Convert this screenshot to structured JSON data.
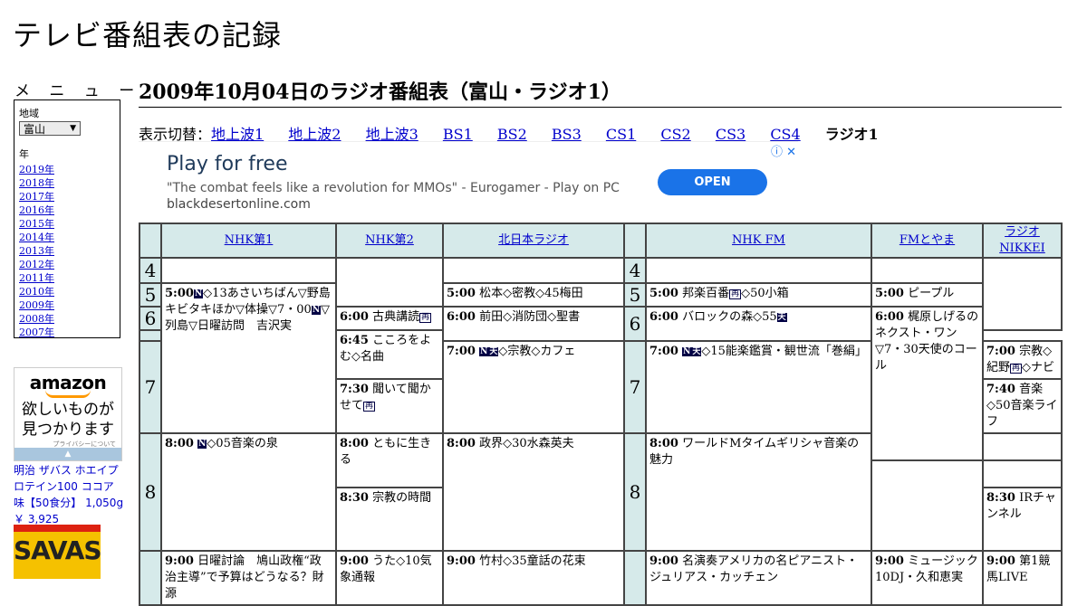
{
  "site": {
    "title": "テレビ番組表の記録"
  },
  "menu": {
    "heading": "メ ニ ュ ー",
    "region_label": "地域",
    "region_value": "富山",
    "year_label": "年",
    "years": [
      "2019年",
      "2018年",
      "2017年",
      "2016年",
      "2015年",
      "2014年",
      "2013年",
      "2012年",
      "2011年",
      "2010年",
      "2009年",
      "2008年",
      "2007年"
    ]
  },
  "amazon": {
    "logo": "amazon",
    "tagline1": "欲しいものが",
    "tagline2": "見つかります",
    "privacy": "プライバシーについて"
  },
  "product": {
    "name": "明治 ザバス ホエイプロテイン100 ココア味【50食分】 1,050g",
    "price": "￥ 3,925",
    "brand": "SAVAS"
  },
  "page": {
    "title": "2009年10月04日のラジオ番組表（富山・ラジオ1）"
  },
  "switcher": {
    "prefix": "表示切替：",
    "links": [
      "地上波1",
      "地上波2",
      "地上波3",
      "BS1",
      "BS2",
      "BS3",
      "CS1",
      "CS2",
      "CS3",
      "CS4"
    ],
    "current": "ラジオ1"
  },
  "ad": {
    "headline": "Play for free",
    "quote": "\"The combat feels like a revolution for MMOs\" - Eurogamer - Play on PC",
    "domain": "blackdesertonline.com",
    "button": "OPEN"
  },
  "schedule": {
    "stations": [
      "NHK第1",
      "NHK第2",
      "北日本ラジオ",
      "NHK FM",
      "FMとやま",
      "ラジオNIKKEI"
    ],
    "hours": [
      "4",
      "5",
      "6",
      "7",
      "8"
    ],
    "marks": {
      "news": "N",
      "stereo": "天",
      "rerun": "再"
    },
    "programs": {
      "nhk1_500": {
        "time": "5:00",
        "a": "◇13あさいちばん▽野島キビタキほか▽体操▽7・00",
        "b": "▽列島▽日曜訪問　吉沢実"
      },
      "nhk1_800": {
        "time": "8:00",
        "a": "◇05音楽の泉"
      },
      "nhk1_900": {
        "time": "9:00",
        "a": "日曜討論　鳩山政権“政治主導”で予算はどうなる？財源"
      },
      "nhk2_600": {
        "time": "6:00",
        "a": "古典講読"
      },
      "nhk2_645": {
        "time": "6:45",
        "a": "こころをよむ◇名曲"
      },
      "nhk2_730": {
        "time": "7:30",
        "a": "聞いて聞かせて"
      },
      "nhk2_800": {
        "time": "8:00",
        "a": "ともに生きる"
      },
      "nhk2_830": {
        "time": "8:30",
        "a": "宗教の時間"
      },
      "nhk2_900": {
        "time": "9:00",
        "a": "うた◇10気象通報"
      },
      "knb_500": {
        "time": "5:00",
        "a": "松本◇密教◇45梅田"
      },
      "knb_600": {
        "time": "6:00",
        "a": "前田◇消防団◇聖書"
      },
      "knb_700": {
        "time": "7:00",
        "a": "◇宗教◇カフェ"
      },
      "knb_800": {
        "time": "8:00",
        "a": "政界◇30水森英夫"
      },
      "knb_900": {
        "time": "9:00",
        "a": "竹村◇35童話の花束"
      },
      "fm_500": {
        "time": "5:00",
        "a": "邦楽百番",
        "b": "◇50小箱"
      },
      "fm_600": {
        "time": "6:00",
        "a": "バロックの森◇55"
      },
      "fm_700": {
        "time": "7:00",
        "a": "◇15能楽鑑賞・観世流「巻絹」"
      },
      "fm_800": {
        "time": "8:00",
        "a": "ワールドMタイムギリシャ音楽の魅力"
      },
      "fm_900": {
        "time": "9:00",
        "a": "名演奏アメリカの名ピアニスト・ジュリアス・カッチェン"
      },
      "fmt_500": {
        "time": "5:00",
        "a": "ピープル"
      },
      "fmt_600": {
        "time": "6:00",
        "a": "梶原しげるのネクスト・ワン▽7・30天使のコール"
      },
      "fmt_900": {
        "time": "9:00",
        "a": "ミュージック10DJ・久和恵実"
      },
      "nik_700": {
        "time": "7:00",
        "a": "宗教◇紀野",
        "b": "◇ナビ"
      },
      "nik_740": {
        "time": "7:40",
        "a": "音楽◇50音楽ライフ"
      },
      "nik_830": {
        "time": "8:30",
        "a": "IRチャンネル"
      },
      "nik_900": {
        "time": "9:00",
        "a": "第1競馬LIVE"
      }
    }
  }
}
